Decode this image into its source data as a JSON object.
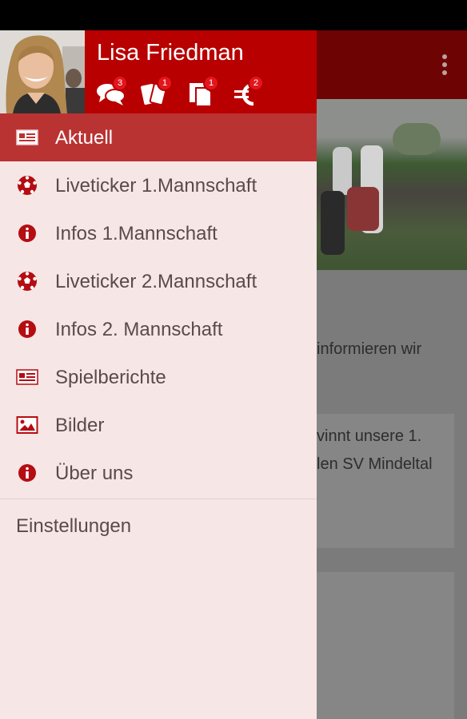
{
  "user": {
    "name": "Lisa Friedman",
    "badges": [
      {
        "icon": "chat-icon",
        "count": "3"
      },
      {
        "icon": "cards-icon",
        "count": "1"
      },
      {
        "icon": "documents-icon",
        "count": "1"
      },
      {
        "icon": "euro-icon",
        "count": "2"
      }
    ]
  },
  "menu": {
    "items": [
      {
        "label": "Aktuell",
        "icon": "news-icon",
        "active": true
      },
      {
        "label": "Liveticker 1.Mannschaft",
        "icon": "soccer-ball-icon"
      },
      {
        "label": "Infos 1.Mannschaft",
        "icon": "info-icon"
      },
      {
        "label": "Liveticker 2.Mannschaft",
        "icon": "soccer-ball-icon"
      },
      {
        "label": "Infos 2. Mannschaft",
        "icon": "info-icon"
      },
      {
        "label": "Spielberichte",
        "icon": "news-icon"
      },
      {
        "label": "Bilder",
        "icon": "image-icon"
      },
      {
        "label": "Über uns",
        "icon": "info-icon"
      }
    ],
    "settings_label": "Einstellungen"
  },
  "background": {
    "text_line_1": "informieren wir",
    "text_line_2": "vinnt unsere 1.",
    "text_line_3": "len SV Mindeltal"
  },
  "colors": {
    "brand_red": "#b80000",
    "active_item": "#ba3333",
    "drawer_bg": "#f7e6e6",
    "icon_red": "#b40d12"
  }
}
